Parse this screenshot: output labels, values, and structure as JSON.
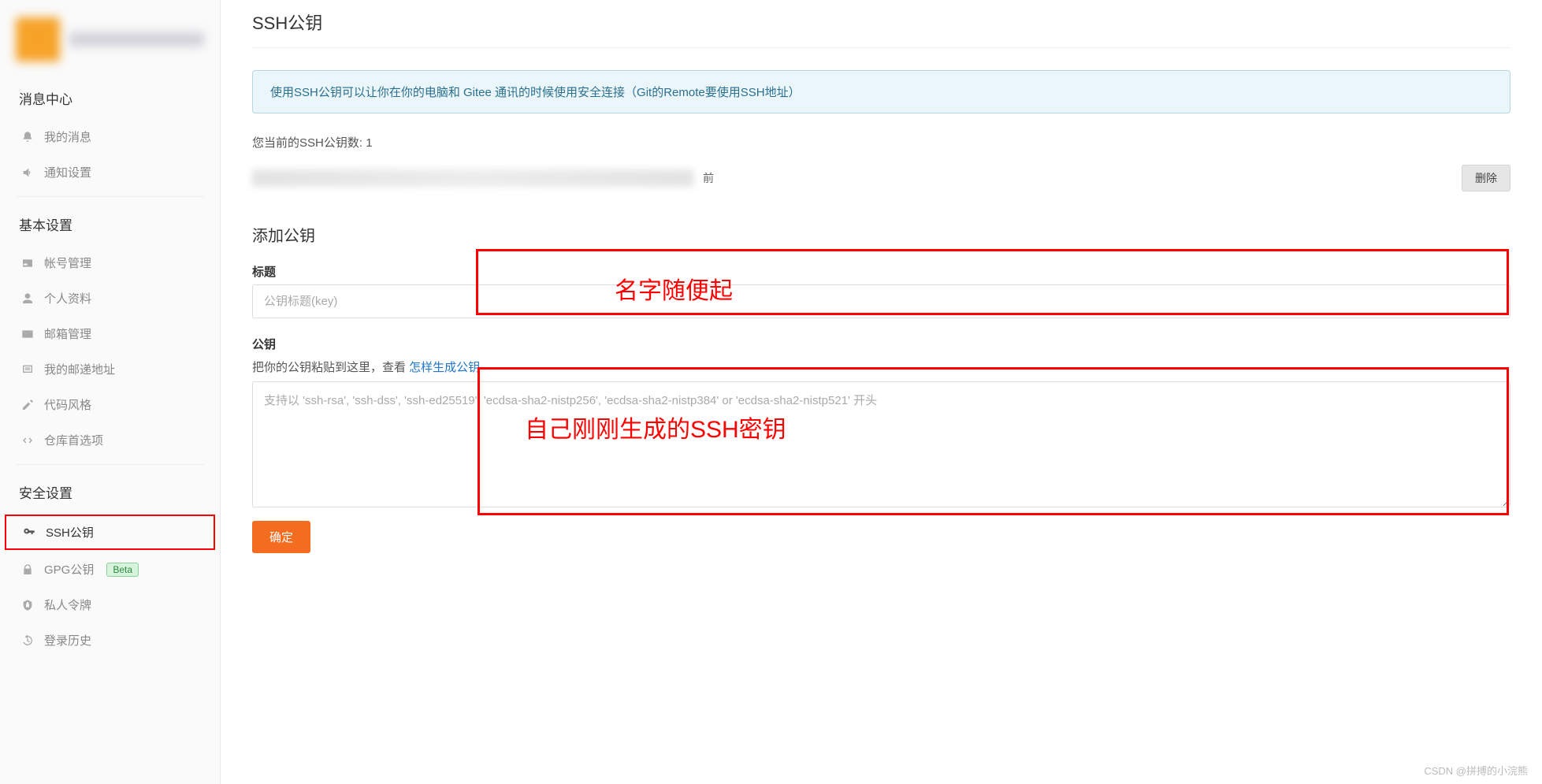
{
  "sidebar": {
    "sections": {
      "message_center": "消息中心",
      "basic_settings": "基本设置",
      "security_settings": "安全设置"
    },
    "items": {
      "my_messages": "我的消息",
      "notify_settings": "通知设置",
      "account_mgmt": "帐号管理",
      "profile": "个人资料",
      "email_mgmt": "邮箱管理",
      "mail_address": "我的邮递地址",
      "code_style": "代码风格",
      "repo_prefs": "仓库首选项",
      "ssh_keys": "SSH公钥",
      "gpg_keys": "GPG公钥",
      "personal_tokens": "私人令牌",
      "login_history": "登录历史"
    },
    "beta_badge": "Beta"
  },
  "main": {
    "page_title": "SSH公钥",
    "info_box": "使用SSH公钥可以让你在你的电脑和 Gitee 通讯的时候使用安全连接（Git的Remote要使用SSH地址）",
    "key_count_prefix": "您当前的SSH公钥数: ",
    "key_count_value": "1",
    "key_time_suffix": "前",
    "delete_btn": "删除",
    "add_key_heading": "添加公钥",
    "title_label": "标题",
    "title_placeholder": "公钥标题(key)",
    "pubkey_label": "公钥",
    "pubkey_hint_prefix": "把你的公钥粘贴到这里，查看 ",
    "pubkey_hint_link": "怎样生成公钥",
    "pubkey_placeholder": "支持以 'ssh-rsa', 'ssh-dss', 'ssh-ed25519', 'ecdsa-sha2-nistp256', 'ecdsa-sha2-nistp384' or 'ecdsa-sha2-nistp521' 开头",
    "confirm_btn": "确定"
  },
  "annotations": {
    "title_note": "名字随便起",
    "key_note": "自己刚刚生成的SSH密钥"
  },
  "watermark": "CSDN @拼搏的小浣熊"
}
